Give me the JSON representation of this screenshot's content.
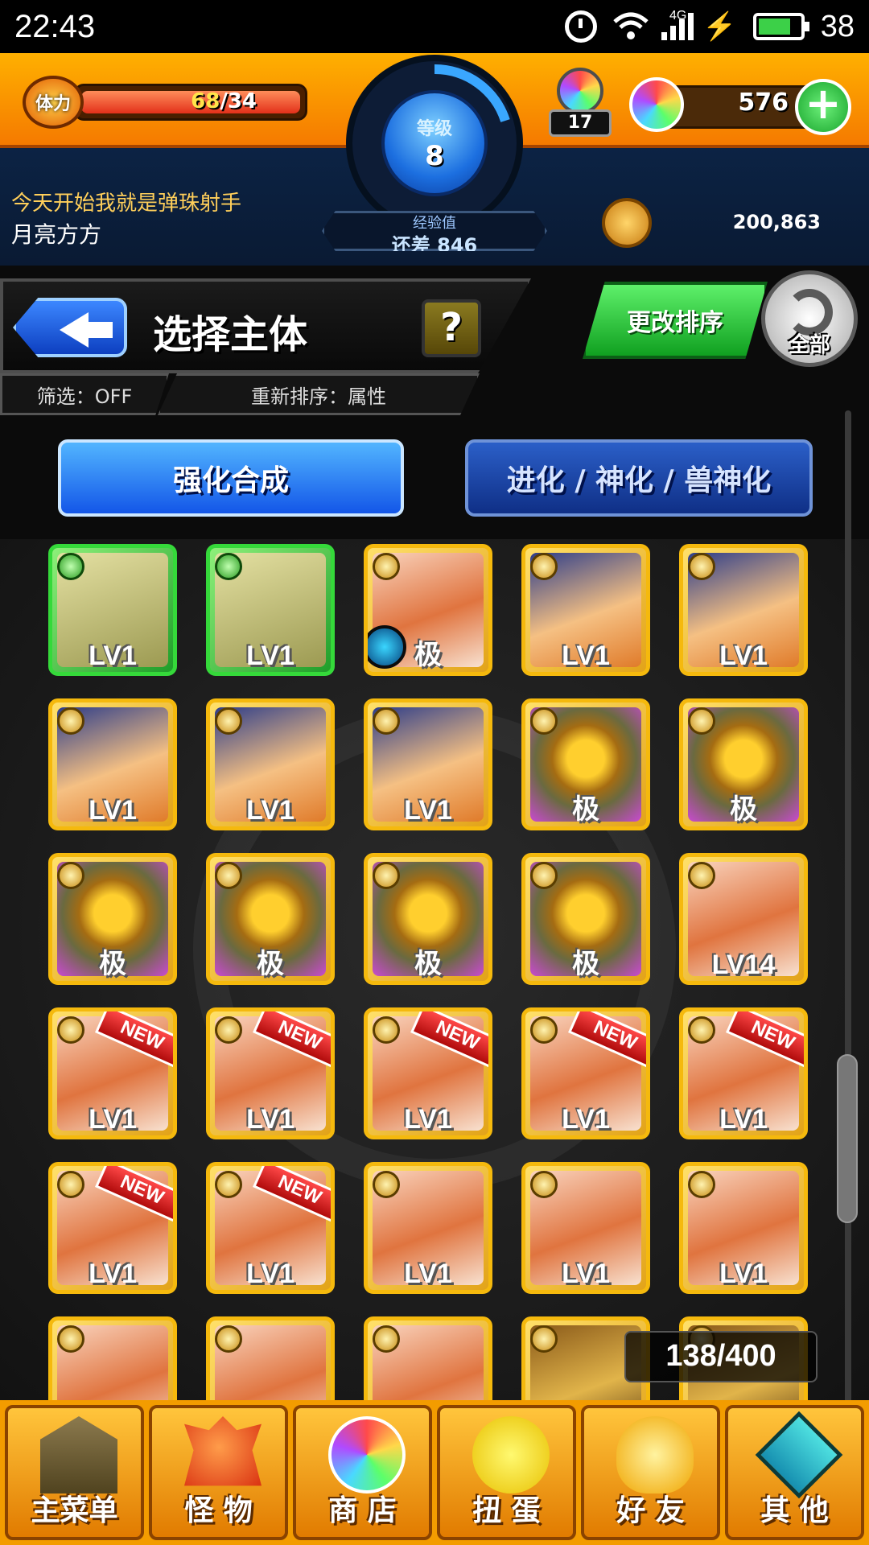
{
  "status_bar": {
    "time": "22:43",
    "network": "4G",
    "battery": "38"
  },
  "header": {
    "stamina_label": "体力",
    "stamina_current": "68",
    "stamina_max": "34",
    "stamina_fill_fraction": 1.0,
    "level_label": "等级",
    "level_value": "8",
    "exp_label": "经验值",
    "exp_value": "还差 846",
    "orb_stock_count": "17",
    "orb_count": "576",
    "player_title": "今天开始我就是弹珠射手",
    "player_name": "月亮方方",
    "coins": "200,863"
  },
  "select": {
    "back_icon": "back-arrow-icon",
    "title": "选择主体",
    "help_label": "?",
    "filter_label": "筛选：OFF",
    "sort_label": "重新排序：属性",
    "change_sort_label": "更改排序",
    "all_label": "全部",
    "tab_enhance": "强化合成",
    "tab_evolve": "进化 / 神化 / 兽神化"
  },
  "grid": {
    "cards": [
      {
        "art": "green",
        "frame": "green",
        "level": "LV1",
        "new": false,
        "gem": false
      },
      {
        "art": "green",
        "frame": "green",
        "level": "LV1",
        "new": false,
        "gem": false
      },
      {
        "art": "girl",
        "frame": "gold",
        "level": "极",
        "new": false,
        "gem": true
      },
      {
        "art": "hero",
        "frame": "gold",
        "level": "LV1",
        "new": false,
        "gem": false
      },
      {
        "art": "hero",
        "frame": "gold",
        "level": "LV1",
        "new": false,
        "gem": false
      },
      {
        "art": "hero",
        "frame": "gold",
        "level": "LV1",
        "new": false,
        "gem": false
      },
      {
        "art": "hero",
        "frame": "gold",
        "level": "LV1",
        "new": false,
        "gem": false
      },
      {
        "art": "hero",
        "frame": "gold",
        "level": "LV1",
        "new": false,
        "gem": false
      },
      {
        "art": "egg",
        "frame": "gold",
        "level": "极",
        "new": false,
        "gem": false
      },
      {
        "art": "egg",
        "frame": "gold",
        "level": "极",
        "new": false,
        "gem": false
      },
      {
        "art": "egg",
        "frame": "gold",
        "level": "极",
        "new": false,
        "gem": false
      },
      {
        "art": "egg",
        "frame": "gold",
        "level": "极",
        "new": false,
        "gem": false
      },
      {
        "art": "egg",
        "frame": "gold",
        "level": "极",
        "new": false,
        "gem": false
      },
      {
        "art": "egg",
        "frame": "gold",
        "level": "极",
        "new": false,
        "gem": false
      },
      {
        "art": "girl",
        "frame": "gold",
        "level": "LV14",
        "new": false,
        "gem": false
      },
      {
        "art": "girl",
        "frame": "gold",
        "level": "LV1",
        "new": true,
        "gem": false
      },
      {
        "art": "girl",
        "frame": "gold",
        "level": "LV1",
        "new": true,
        "gem": false
      },
      {
        "art": "girl",
        "frame": "gold",
        "level": "LV1",
        "new": true,
        "gem": false
      },
      {
        "art": "girl",
        "frame": "gold",
        "level": "LV1",
        "new": true,
        "gem": false
      },
      {
        "art": "girl",
        "frame": "gold",
        "level": "LV1",
        "new": true,
        "gem": false
      },
      {
        "art": "girl",
        "frame": "gold",
        "level": "LV1",
        "new": true,
        "gem": false
      },
      {
        "art": "girl",
        "frame": "gold",
        "level": "LV1",
        "new": true,
        "gem": false
      },
      {
        "art": "girl",
        "frame": "gold",
        "level": "LV1",
        "new": false,
        "gem": false
      },
      {
        "art": "girl",
        "frame": "gold",
        "level": "LV1",
        "new": false,
        "gem": false
      },
      {
        "art": "girl",
        "frame": "gold",
        "level": "LV1",
        "new": false,
        "gem": false
      },
      {
        "art": "girl",
        "frame": "gold",
        "level": "",
        "new": false,
        "gem": false
      },
      {
        "art": "girl",
        "frame": "gold",
        "level": "",
        "new": false,
        "gem": false
      },
      {
        "art": "girl",
        "frame": "gold",
        "level": "",
        "new": false,
        "gem": false
      },
      {
        "art": "gold",
        "frame": "gold",
        "level": "",
        "new": false,
        "gem": false
      },
      {
        "art": "gold",
        "frame": "gold",
        "level": "",
        "new": false,
        "gem": false
      }
    ],
    "new_label": "NEW",
    "box_count": "138/400"
  },
  "bottom_nav": {
    "items": [
      {
        "label": "主菜单",
        "icon": "home-gate-icon"
      },
      {
        "label": "怪 物",
        "icon": "monster-icon"
      },
      {
        "label": "商 店",
        "icon": "orb-shop-icon"
      },
      {
        "label": "扭 蛋",
        "icon": "gacha-egg-icon"
      },
      {
        "label": "好 友",
        "icon": "friends-icon"
      },
      {
        "label": "其 他",
        "icon": "other-icon"
      }
    ]
  }
}
